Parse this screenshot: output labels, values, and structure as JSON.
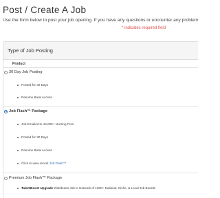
{
  "page": {
    "title": "Post / Create A Job",
    "intro": "Use the form below to post your job opening. If you have any questions or encounter any problems, please",
    "required_note": "* indicates required field"
  },
  "panel": {
    "title": "Type of Job Posting",
    "column_header": "Product"
  },
  "options": [
    {
      "label": "30 Day Job Posting",
      "selected": false,
      "features": [
        "Posted for 30 Days",
        "Resume Bank Access"
      ]
    },
    {
      "label": "Job Flash™ Package",
      "selected": true,
      "features": [
        "Job Emailed to 44,000+ Nursing Pros",
        "Posted for 30 Days",
        "Resume Bank Access"
      ],
      "link_prefix": "Click to view recent ",
      "link_text": "Job Flash™"
    },
    {
      "label": "Premium Job Flash™ Package",
      "selected": false,
      "feature_strong": "TalentBoost Upgrade",
      "feature_rest": " Distributes Job to Network of 1000+ National, Niche, & Local Job Boards"
    }
  ],
  "colors": {
    "required": "#d9534f",
    "link": "#2a6ebb",
    "panel_header_bg": "#f5f5f5",
    "border": "#dddddd"
  }
}
